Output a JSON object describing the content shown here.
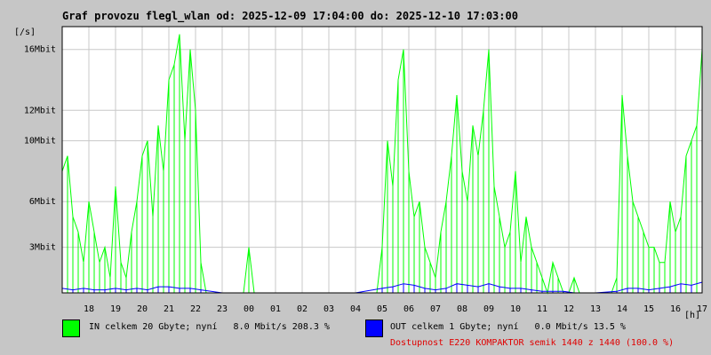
{
  "header": {
    "title": "Graf provozu flegl_wlan od: 2025-12-09 17:04:00 do: 2025-12-10 17:03:00",
    "unit": "[/s]",
    "x_unit": "[h]"
  },
  "legend": {
    "in": {
      "color": "#00ff00",
      "text": "IN celkem 20 Gbyte; nyní   8.0 Mbit/s 208.3 %"
    },
    "out": {
      "color": "#0000ff",
      "text": "OUT celkem 1 Gbyte; nyní   0.0 Mbit/s 13.5 %"
    }
  },
  "status": {
    "text": "Dostupnost E220 KOMPAKTOR semik 1440 z 1440 (100.0 %)",
    "color": "#e00000"
  },
  "chart_data": {
    "type": "area",
    "ylim": [
      0,
      17.5
    ],
    "yticks": [
      {
        "value": 3,
        "label": "3Mbit"
      },
      {
        "value": 6,
        "label": "6Mbit"
      },
      {
        "value": 10,
        "label": "10Mbit"
      },
      {
        "value": 12,
        "label": "12Mbit"
      },
      {
        "value": 16,
        "label": "16Mbit"
      }
    ],
    "xlim": [
      17.0,
      41.0
    ],
    "xticks": [
      {
        "value": 18,
        "label": "18"
      },
      {
        "value": 19,
        "label": "19"
      },
      {
        "value": 20,
        "label": "20"
      },
      {
        "value": 21,
        "label": "21"
      },
      {
        "value": 22,
        "label": "22"
      },
      {
        "value": 23,
        "label": "23"
      },
      {
        "value": 24,
        "label": "00"
      },
      {
        "value": 25,
        "label": "01"
      },
      {
        "value": 26,
        "label": "02"
      },
      {
        "value": 27,
        "label": "03"
      },
      {
        "value": 28,
        "label": "04"
      },
      {
        "value": 29,
        "label": "05"
      },
      {
        "value": 30,
        "label": "06"
      },
      {
        "value": 31,
        "label": "07"
      },
      {
        "value": 32,
        "label": "08"
      },
      {
        "value": 33,
        "label": "09"
      },
      {
        "value": 34,
        "label": "10"
      },
      {
        "value": 35,
        "label": "11"
      },
      {
        "value": 36,
        "label": "12"
      },
      {
        "value": 37,
        "label": "13"
      },
      {
        "value": 38,
        "label": "14"
      },
      {
        "value": 39,
        "label": "15"
      },
      {
        "value": 40,
        "label": "16"
      },
      {
        "value": 41,
        "label": "17"
      }
    ],
    "grid": true,
    "series": [
      {
        "name": "IN",
        "color": "#00ff00",
        "x": [
          17.0,
          17.2,
          17.4,
          17.6,
          17.8,
          18.0,
          18.2,
          18.4,
          18.6,
          18.8,
          19.0,
          19.2,
          19.4,
          19.6,
          19.8,
          20.0,
          20.2,
          20.4,
          20.6,
          20.8,
          21.0,
          21.2,
          21.4,
          21.6,
          21.8,
          22.0,
          22.2,
          22.4,
          22.6,
          22.8,
          23.0,
          23.2,
          23.4,
          23.6,
          23.8,
          24.0,
          24.2,
          24.4,
          24.6,
          24.8,
          25.0,
          25.2,
          25.4,
          25.6,
          25.8,
          26.0,
          26.2,
          26.4,
          26.6,
          26.8,
          27.0,
          27.2,
          27.4,
          27.6,
          27.8,
          28.0,
          28.2,
          28.4,
          28.6,
          28.8,
          29.0,
          29.2,
          29.4,
          29.6,
          29.8,
          30.0,
          30.2,
          30.4,
          30.6,
          30.8,
          31.0,
          31.2,
          31.4,
          31.6,
          31.8,
          32.0,
          32.2,
          32.4,
          32.6,
          32.8,
          33.0,
          33.2,
          33.4,
          33.6,
          33.8,
          34.0,
          34.2,
          34.4,
          34.6,
          34.8,
          35.0,
          35.2,
          35.4,
          35.6,
          35.8,
          36.0,
          36.2,
          36.4,
          36.6,
          36.8,
          37.0,
          37.2,
          37.4,
          37.6,
          37.8,
          38.0,
          38.2,
          38.4,
          38.6,
          38.8,
          39.0,
          39.2,
          39.4,
          39.6,
          39.8,
          40.0,
          40.2,
          40.4,
          40.6,
          40.8,
          41.0
        ],
        "values": [
          8,
          9,
          5,
          4,
          2,
          6,
          4,
          2,
          3,
          1,
          7,
          2,
          1,
          4,
          6,
          9,
          10,
          5,
          11,
          8,
          14,
          15,
          17,
          10,
          16,
          12,
          2,
          0,
          0,
          0,
          0,
          0,
          0,
          0,
          0,
          3,
          0,
          0,
          0,
          0,
          0,
          0,
          0,
          0,
          0,
          0,
          0,
          0,
          0,
          0,
          0,
          0,
          0,
          0,
          0,
          0,
          0,
          0,
          0,
          0,
          3,
          10,
          7,
          14,
          16,
          8,
          5,
          6,
          3,
          2,
          1,
          4,
          6,
          9,
          13,
          8,
          6,
          11,
          9,
          12,
          16,
          7,
          5,
          3,
          4,
          8,
          2,
          5,
          3,
          2,
          1,
          0,
          2,
          1,
          0,
          0,
          1,
          0,
          0,
          0,
          0,
          0,
          0,
          0,
          1,
          13,
          9,
          6,
          5,
          4,
          3,
          3,
          2,
          2,
          6,
          4,
          5,
          9,
          10,
          11,
          16
        ]
      },
      {
        "name": "OUT",
        "color": "#0000ff",
        "x": [
          17.0,
          17.4,
          17.8,
          18.2,
          18.6,
          19.0,
          19.4,
          19.8,
          20.2,
          20.6,
          21.0,
          21.4,
          21.8,
          22.2,
          23.0,
          24.0,
          25.0,
          26.0,
          27.0,
          28.0,
          29.0,
          29.4,
          29.8,
          30.2,
          30.6,
          31.0,
          31.4,
          31.8,
          32.2,
          32.6,
          33.0,
          33.4,
          33.8,
          34.2,
          34.6,
          35.0,
          35.4,
          35.8,
          36.2,
          37.0,
          37.8,
          38.2,
          38.6,
          39.0,
          39.4,
          39.8,
          40.2,
          40.6,
          41.0
        ],
        "values": [
          0.3,
          0.2,
          0.3,
          0.2,
          0.2,
          0.3,
          0.2,
          0.3,
          0.2,
          0.4,
          0.4,
          0.3,
          0.3,
          0.2,
          0,
          0,
          0,
          0,
          0,
          0,
          0.3,
          0.4,
          0.6,
          0.5,
          0.3,
          0.2,
          0.3,
          0.6,
          0.5,
          0.4,
          0.6,
          0.4,
          0.3,
          0.3,
          0.2,
          0.1,
          0.1,
          0.1,
          0,
          0,
          0.1,
          0.3,
          0.3,
          0.2,
          0.3,
          0.4,
          0.6,
          0.5,
          0.7
        ]
      }
    ]
  }
}
